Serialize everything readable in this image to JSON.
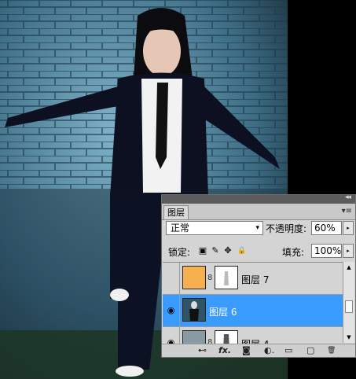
{
  "panel": {
    "collapse_glyph": "◂◂",
    "tab_label": "图层",
    "menu_glyph": "▾≡",
    "blend_mode": "正常",
    "blend_arrow": "▾",
    "opacity_label": "不透明度:",
    "opacity_value": "60%",
    "lock_label": "锁定:",
    "fill_label": "填充:",
    "fill_value": "100%",
    "step_glyph": "▸"
  },
  "layers": [
    {
      "name": "图层 7",
      "visible": false,
      "selected": false,
      "thumb": "orange-fill",
      "chain": "8"
    },
    {
      "name": "图层 6",
      "visible": true,
      "selected": true,
      "thumb": "photo",
      "chain": ""
    },
    {
      "name": "图层 4",
      "visible": true,
      "selected": false,
      "thumb": "photo-gray",
      "chain": "8"
    }
  ],
  "icons": {
    "eye": "◉",
    "lock_pixels": "▣",
    "lock_brush": "✎",
    "lock_move": "✥",
    "lock_all": "🔒",
    "scroll_up": "▲",
    "scroll_down": "▼",
    "footer": [
      "⊷",
      "fx.",
      "◙",
      "◐.",
      "▭",
      "▢",
      "🗑"
    ]
  },
  "colors": {
    "selected": "#3a9bff",
    "orange_thumb": "#f7b04e",
    "wall": "#3f6f86"
  }
}
